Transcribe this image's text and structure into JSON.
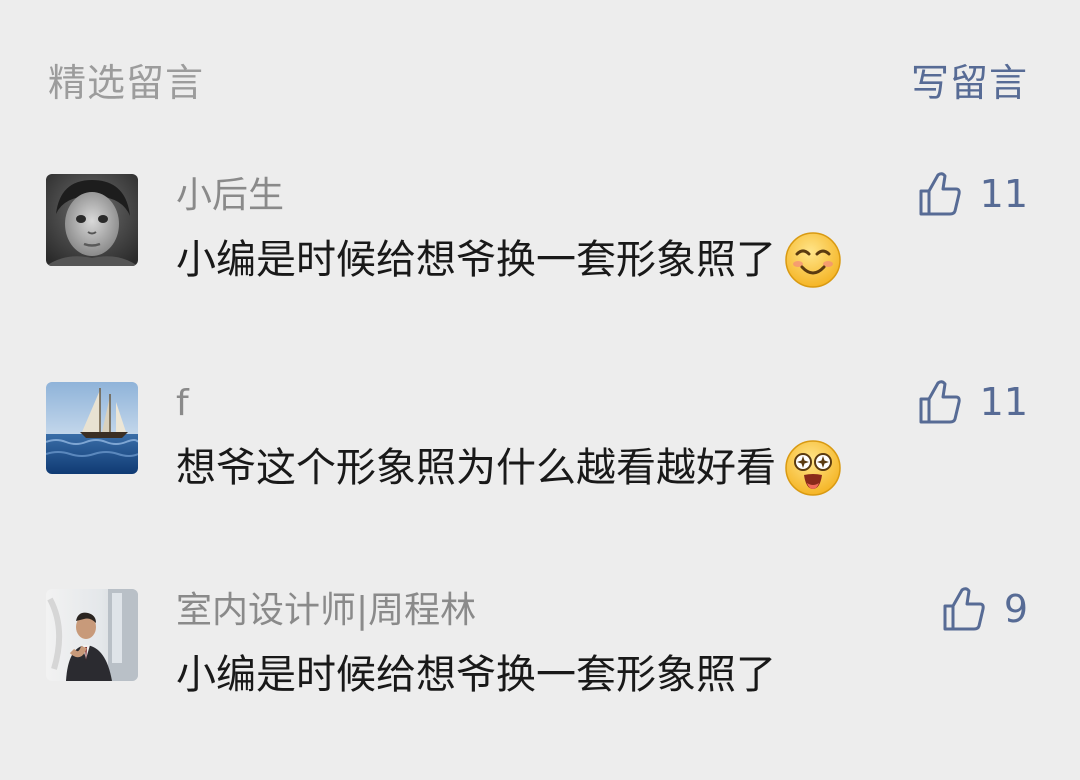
{
  "header": {
    "title": "精选留言",
    "write_label": "写留言"
  },
  "comments": [
    {
      "nickname": "小后生",
      "content": "小编是时候给想爷换一套形象照了",
      "emoji": "blush-smile-emoji",
      "likes": "11"
    },
    {
      "nickname": "f",
      "content": "想爷这个形象照为什么越看越好看",
      "emoji": "star-struck-emoji",
      "likes": "11"
    },
    {
      "nickname": "室内设计师|周程林",
      "content": "小编是时候给想爷换一套形象照了",
      "emoji": "",
      "likes": "9"
    }
  ],
  "colors": {
    "background": "#ededed",
    "link": "#576b95",
    "muted": "#9c9c9c",
    "text": "#191919"
  }
}
